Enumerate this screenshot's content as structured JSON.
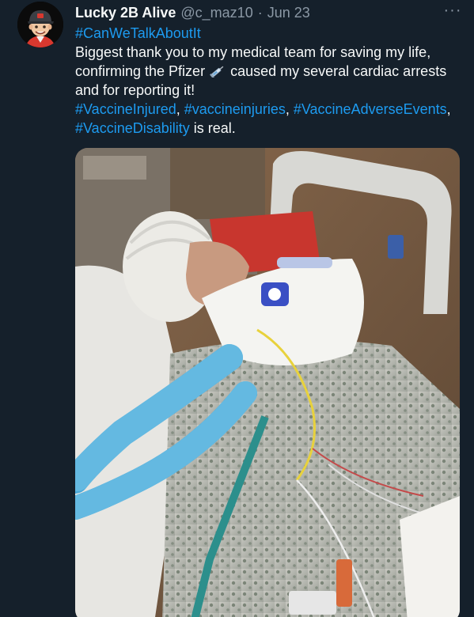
{
  "tweet": {
    "author": {
      "display_name": "Lucky 2B Alive",
      "handle": "@c_maz10",
      "avatar_icon": "cartoon-avatar-icon"
    },
    "separator": "·",
    "date": "Jun 23",
    "more_icon": "more-horizontal-icon",
    "more_label": "···",
    "text": {
      "hashtag_first": "#CanWeTalkAboutIt",
      "line1": "Biggest thank you to my medical team for saving my life,",
      "line2_before": "confirming the Pfizer",
      "line2_emoji": "syringe-icon",
      "line2_after": " caused my several cardiac arrests",
      "line3": "and for reporting it!",
      "hashtag_a": "#VaccineInjured",
      "hashtag_b": "#vaccineinjuries",
      "hashtag_c": "#VaccineAdverseEvents",
      "comma": ", ",
      "hashtag_d": "#VaccineDisability",
      "line5_after": " is real."
    },
    "media": {
      "kind": "photo",
      "accent_colors": {
        "link": "#1d9bf0",
        "muted": "#8b98a5",
        "background": "#15202b",
        "tubing": "#4aa8d8"
      }
    }
  }
}
